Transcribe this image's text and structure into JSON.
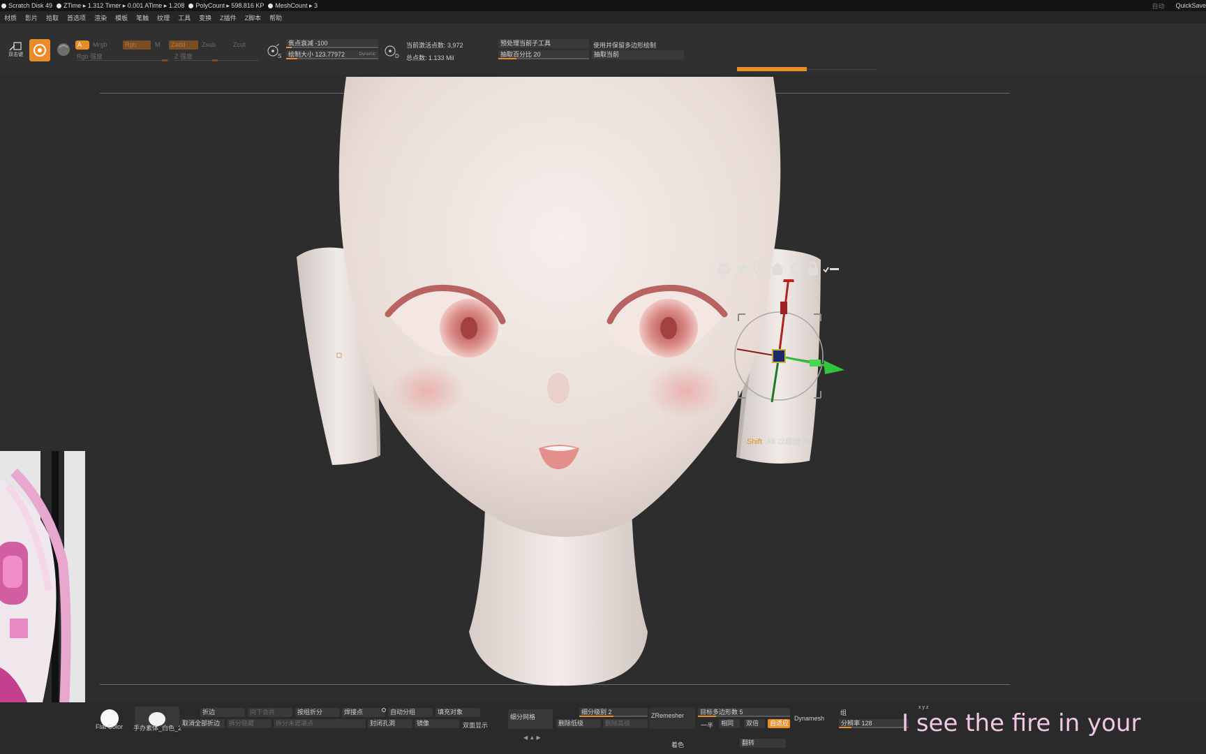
{
  "status_bar": {
    "items": [
      "Scratch Disk 49",
      "ZTime ▸ 1.312 Timer ▸ 0.001 ATime ▸ 1.208",
      "PolyCount ▸ 598.816 KP",
      "MeshCount ▸ 3"
    ],
    "right": [
      "自动",
      "QuickSave"
    ]
  },
  "menu": [
    "材质",
    "影片",
    "拾取",
    "首选项",
    "渲染",
    "模板",
    "笔触",
    "纹理",
    "工具",
    "变换",
    "Z插件",
    "Z脚本",
    "帮助"
  ],
  "toolbar": {
    "edit_label": "双击键",
    "a_label": "A",
    "mrgb": "Mrgb",
    "rgb": "Rgb",
    "m": "M",
    "zadd": "Zadd",
    "zsub": "Zsub",
    "zcut": "Zcut",
    "rgb_intensity": "Rgb 强度",
    "z_intensity": "Z 强度",
    "focal_shift": "焦点衰减 -100",
    "draw_size": "绘制大小 123.77972",
    "dynamic": "Dynamic",
    "s_label": "S",
    "d_label": "D",
    "active_points": "当前激活点数: 3,972",
    "total_points": "总点数: 1.133 Mil",
    "preprocess": "预处理当前子工具",
    "extract_pct": "抽取百分比 20",
    "keep_polypaint": "使用并保留多边形绘制",
    "extract_current": "抽取当前",
    "draw_size_fill": 0.12,
    "extract_pct_fill": 0.2
  },
  "gizmo": {
    "icons": [
      "gear-icon",
      "pin-icon",
      "location-icon",
      "home-icon",
      "reset-icon",
      "lock-icon",
      "minus-icon"
    ],
    "hint_key": "Shift",
    "hint_text": "Alt 以缩放 XZ"
  },
  "bottom": {
    "material_label": "Flat Color",
    "brush_label": "手办素体_白色_2",
    "crease": "折边",
    "merge_down": "向下合并",
    "split_groups": "按组折分",
    "weld_points": "焊接点",
    "auto_groups": "自动分组",
    "fill_object": "填充对象",
    "uncrease_all": "取消全部折边",
    "split_hidden": "拆分隐藏",
    "split_unmasked": "拆分未遮罩点",
    "close_holes": "封闭孔洞",
    "mirror": "镜像",
    "double_sided": "双面显示",
    "subdivide": "细分网格",
    "sdiv_level": "细分级别 2",
    "delete_lower": "删除低级",
    "delete_higher": "删除高级",
    "zremesher": "ZRemesher",
    "target_polycount": "目标多边形数 5",
    "half": "一半",
    "same": "相同",
    "double": "双倍",
    "adaptive": "自适应",
    "dynamesh": "Dynamesh",
    "group": "组",
    "resolution": "分辨率 128",
    "colorize": "着色",
    "flip": "翻转",
    "xyz": "x y z",
    "arrows": "◀ ▲ ▶"
  },
  "subtitle": "I see the fire in your"
}
